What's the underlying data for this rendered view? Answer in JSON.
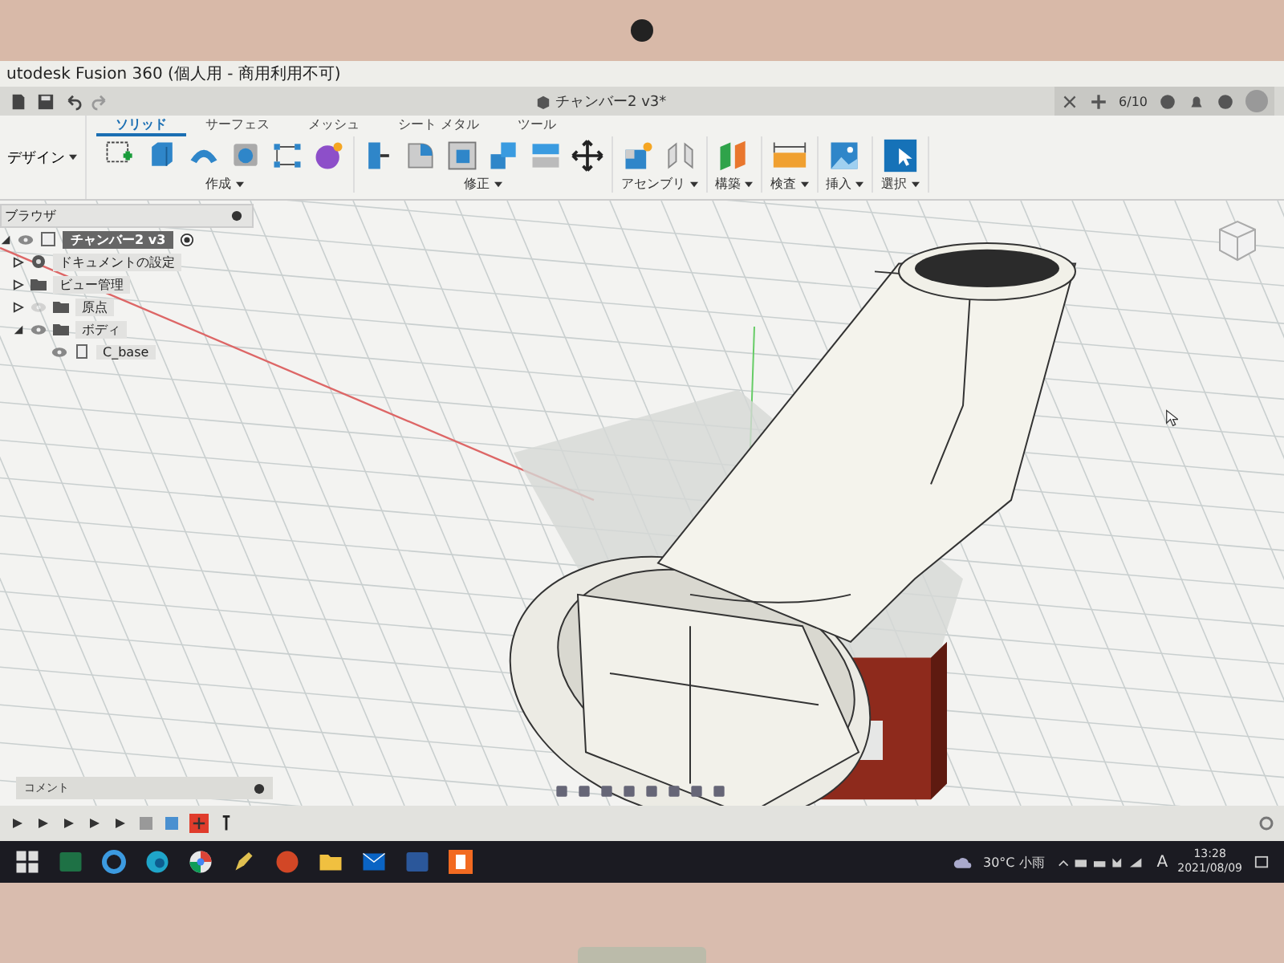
{
  "window": {
    "title": "utodesk Fusion 360 (個人用 - 商用利用不可)"
  },
  "document_tab": {
    "title": "チャンバー2 v3*"
  },
  "job_status": "6/10",
  "workspace": {
    "label": "デザイン"
  },
  "toolbar_tabs": [
    {
      "label": "ソリッド",
      "selected": true
    },
    {
      "label": "サーフェス",
      "selected": false
    },
    {
      "label": "メッシュ",
      "selected": false
    },
    {
      "label": "シート メタル",
      "selected": false
    },
    {
      "label": "ツール",
      "selected": false
    }
  ],
  "toolbar_groups": [
    {
      "label": "作成",
      "tools": [
        {
          "kind": "sketch"
        },
        {
          "kind": "box"
        },
        {
          "kind": "arch"
        },
        {
          "kind": "hollow"
        },
        {
          "kind": "nodes"
        },
        {
          "kind": "form"
        }
      ]
    },
    {
      "label": "修正",
      "tools": [
        {
          "kind": "pressrect"
        },
        {
          "kind": "fillet"
        },
        {
          "kind": "shellbox"
        },
        {
          "kind": "stack"
        },
        {
          "kind": "split"
        },
        {
          "kind": "move"
        }
      ]
    },
    {
      "label": "アセンブリ",
      "tools": [
        {
          "kind": "component"
        },
        {
          "kind": "joint"
        }
      ]
    },
    {
      "label": "構築",
      "tools": [
        {
          "kind": "planes"
        }
      ]
    },
    {
      "label": "検査",
      "tools": [
        {
          "kind": "ruler"
        }
      ]
    },
    {
      "label": "挿入",
      "tools": [
        {
          "kind": "picture"
        }
      ]
    },
    {
      "label": "選択",
      "tools": [
        {
          "kind": "select"
        }
      ]
    }
  ],
  "browser": {
    "title": "ブラウザ",
    "tree": [
      {
        "label": "チャンバー2 v3",
        "kind": "component",
        "expanded": true,
        "visible": true,
        "children": [
          {
            "label": "ドキュメントの設定",
            "kind": "settings",
            "expanded": false
          },
          {
            "label": "ビュー管理",
            "kind": "folder",
            "expanded": false
          },
          {
            "label": "原点",
            "kind": "folder",
            "expanded": false,
            "visible": false
          },
          {
            "label": "ボディ",
            "kind": "folder",
            "expanded": true,
            "visible": true,
            "children": [
              {
                "label": "C_base",
                "kind": "body",
                "visible": true
              }
            ]
          }
        ]
      }
    ]
  },
  "comments": {
    "title": "コメント"
  },
  "taskbar": {
    "apps": [
      {
        "kind": "start"
      },
      {
        "kind": "sheet"
      },
      {
        "kind": "ie"
      },
      {
        "kind": "edge"
      },
      {
        "kind": "chrome"
      },
      {
        "kind": "pen"
      },
      {
        "kind": "slides"
      },
      {
        "kind": "folder"
      },
      {
        "kind": "mail"
      },
      {
        "kind": "doc"
      },
      {
        "kind": "fusion"
      }
    ],
    "weather": "30°C 小雨",
    "ime": "A",
    "time": "13:28",
    "date": "2021/08/09"
  }
}
